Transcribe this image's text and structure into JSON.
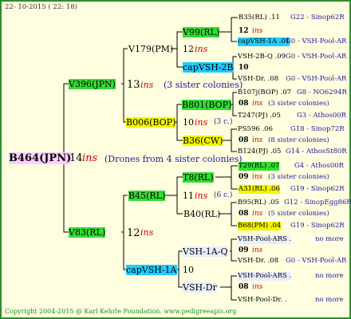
{
  "header": "22- 10-2015 ( 22: 18)",
  "footer": "Copyright 2004-2015 @ Karl Kehrle Foundation.   www.pedigreeapis.org",
  "root": {
    "name": "B464(JPN)",
    "num": "14",
    "ins": "ins",
    "note": "(Drones from 4 sister colonies)"
  },
  "g1": [
    {
      "name": "V396(JPN)",
      "num": "13",
      "ins": "ins",
      "note": "(3 sister colonies)"
    },
    {
      "name": "V83(RL)",
      "num": "12",
      "ins": "ins"
    }
  ],
  "g2": [
    {
      "name": "V179(PM)",
      "num": "12",
      "ins": "ins"
    },
    {
      "name": "B006(BOP)",
      "num": "10",
      "ins": "ins",
      "note": "(3 c.)"
    },
    {
      "name": "B45(RL)",
      "num": "11",
      "ins": "ins",
      "note": "(6 c.)"
    },
    {
      "name": "capVSH-1A",
      "num": "10"
    }
  ],
  "g3": [
    {
      "name": "V99(RL)",
      "num": "12",
      "ins": "ins"
    },
    {
      "name": "capVSH-2B",
      "num": "10"
    },
    {
      "name": "B801(BOP)",
      "num": "08",
      "ins": "ins",
      "note": "(3 sister colonies)"
    },
    {
      "name": "B36(CW)",
      "num": "08",
      "ins": "ins",
      "note": "(8 sister colonies)"
    },
    {
      "name": "T8(RL)",
      "num": "09",
      "ins": "ins",
      "note": "(3 sister colonies)"
    },
    {
      "name": "B40(RL)",
      "num": "08",
      "ins": "ins",
      "note": "(5 sister colonies)"
    },
    {
      "name": "VSH-1A-Q",
      "num": "09",
      "ins": "ins"
    },
    {
      "name": "VSH-Dr",
      "num": "08",
      "ins": "ins"
    }
  ],
  "g4": [
    {
      "name": "B35(RL) .11",
      "src": "G22 - Sinop62R"
    },
    {
      "name": "capVSH-1A .01",
      "src": "G0 - VSH-Pool-AR"
    },
    {
      "name": "VSH-2B-Q .09",
      "src": "G0 - VSH-Pool-AR"
    },
    {
      "name": "VSH-Dr. .08",
      "src": "G0 - VSH-Pool-AR"
    },
    {
      "name": "B107j(BOP) .07",
      "src": "G8 - NO6294R"
    },
    {
      "name": "T247(PJ) .05",
      "src": "G3 - Athos00R"
    },
    {
      "name": "PS596 .06",
      "src": "G18 - Sinop72R"
    },
    {
      "name": "B124(PJ) .05",
      "src": "G14 - AthosSt80R"
    },
    {
      "name": "T29(RL) .07",
      "src": "G4 - Athos00R"
    },
    {
      "name": "A31(RL) .06",
      "src": "G19 - Sinop62R"
    },
    {
      "name": "B95(RL) .05",
      "src": "G12 - SinopEgg86R"
    },
    {
      "name": "B68(PM) .04",
      "src": "G19 - Sinop62R"
    },
    {
      "name": "VSH-Pool-ARS .",
      "src": "no more"
    },
    {
      "name": "VSH-Dr. .08",
      "src": "G0 - VSH-Pool-AR"
    },
    {
      "name": "VSH-Pool-ARS .",
      "src": "no more"
    },
    {
      "name": "VSH-Pool-Dr. .",
      "src": "no more"
    }
  ]
}
